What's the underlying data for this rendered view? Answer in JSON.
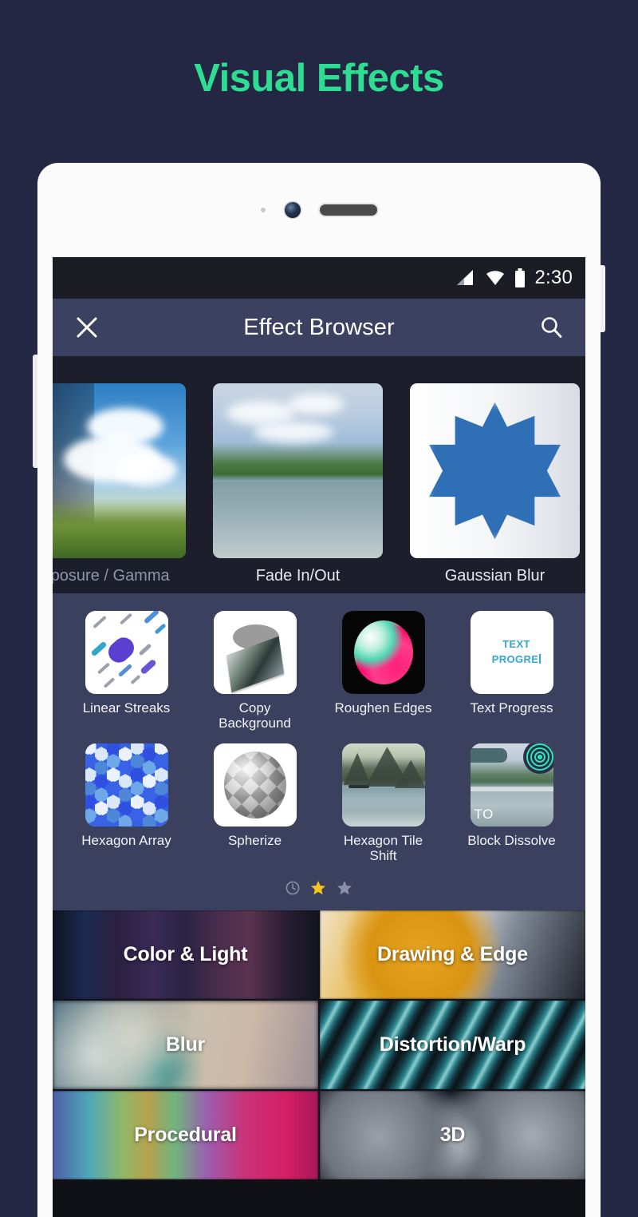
{
  "page": {
    "title": "Visual Effects",
    "accent_color": "#2fdd92",
    "background_color": "#232743"
  },
  "device": {
    "hardware": {
      "sensor": "proximity-sensor",
      "camera": "front-camera",
      "speaker": "earpiece-speaker",
      "volume_button": "volume-button",
      "power_button": "power-button"
    }
  },
  "status_bar": {
    "time": "2:30",
    "icons": [
      "signal-icon",
      "wifi-icon",
      "battery-icon"
    ],
    "background_color": "#1b1c24"
  },
  "app_bar": {
    "close_label": "✕",
    "title": "Effect Browser",
    "search_label": "Search",
    "background_color": "#3c4161"
  },
  "featured": {
    "items": [
      {
        "label": "Exposure / Gamma",
        "dim": true
      },
      {
        "label": "Fade In/Out",
        "dim": false
      },
      {
        "label": "Gaussian Blur",
        "dim": false
      }
    ]
  },
  "effects_grid": {
    "rows": [
      [
        {
          "label": "Linear Streaks",
          "art": "linear-streaks"
        },
        {
          "label": "Copy Background",
          "art": "copy-background"
        },
        {
          "label": "Roughen Edges",
          "art": "roughen-edges"
        },
        {
          "label": "Text Progress",
          "art": "text-progress"
        }
      ],
      [
        {
          "label": "Hexagon Array",
          "art": "hexagon-array"
        },
        {
          "label": "Spherize",
          "art": "spherize"
        },
        {
          "label": "Hexagon Tile Shift",
          "art": "hexagon-tile-shift"
        },
        {
          "label": "Block Dissolve",
          "art": "block-dissolve"
        }
      ]
    ],
    "text_progress_tile": {
      "line1": "TEXT",
      "line2": "PROGRE",
      "text_color": "#34a7d8"
    },
    "block_dissolve_tile": {
      "overlay_text": "TO",
      "badge": "ripple-icon",
      "badge_color": "#2ee6b8"
    },
    "background_color": "#3b405e"
  },
  "pager": {
    "items": [
      {
        "icon": "clock-icon",
        "active": false,
        "color": "#8a8fa6"
      },
      {
        "icon": "star-icon",
        "active": true,
        "color": "#f5c518"
      },
      {
        "icon": "star-icon",
        "active": false,
        "color": "#8a8fa6"
      }
    ]
  },
  "categories": {
    "rows": [
      [
        {
          "label": "Color & Light",
          "art": "color-light"
        },
        {
          "label": "Drawing & Edge",
          "art": "drawing-edge"
        }
      ],
      [
        {
          "label": "Blur",
          "art": "blur"
        },
        {
          "label": "Distortion/Warp",
          "art": "distortion-warp"
        }
      ],
      [
        {
          "label": "Procedural",
          "art": "procedural"
        },
        {
          "label": "3D",
          "art": "three-d"
        }
      ]
    ]
  }
}
